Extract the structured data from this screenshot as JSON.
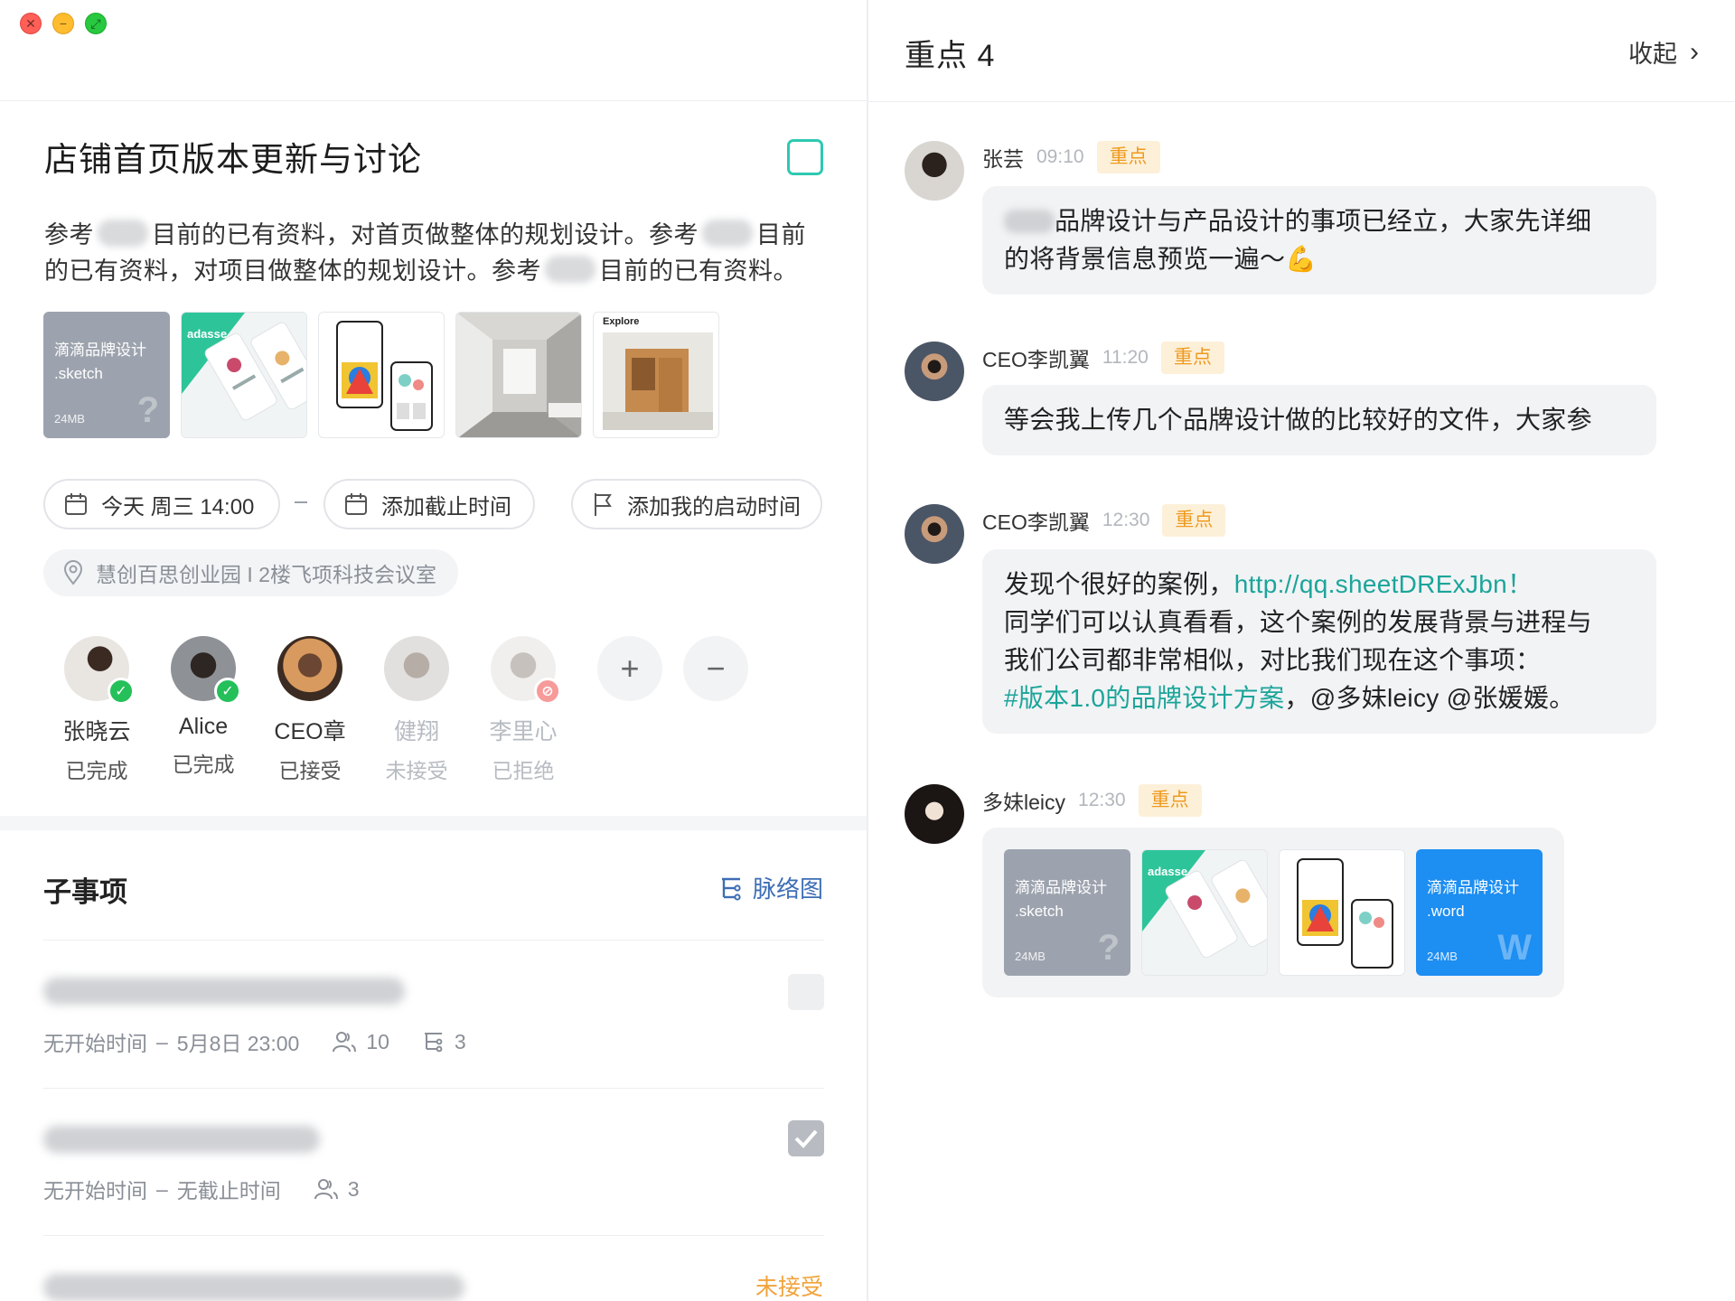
{
  "window": {
    "close_glyph": "✕",
    "minimize_glyph": "−",
    "zoom_glyph": "⤢"
  },
  "task": {
    "title": "店铺首页版本更新与讨论",
    "description_parts": [
      "参考",
      "目前的已有资料，对首页做整体的规划设计。参考",
      "目前",
      "的已有资料，对项目做整体的规划设计。参考",
      "目前的已有资料。"
    ],
    "attachments": [
      {
        "type": "file",
        "name": "滴滴品牌设计",
        "ext": ".sketch",
        "size": "24MB",
        "icon": "question-mark-icon"
      },
      {
        "type": "image",
        "label": "adasse"
      },
      {
        "type": "image",
        "label": ""
      },
      {
        "type": "image",
        "label": ""
      },
      {
        "type": "image",
        "label": "Explore"
      }
    ],
    "start_time": "今天 周三 14:00",
    "add_deadline": "添加截止时间",
    "add_my_start": "添加我的启动时间",
    "location": "慧创百思创业园 I 2楼飞项科技会议室",
    "members": [
      {
        "name": "张晓云",
        "status": "已完成",
        "badge": "done"
      },
      {
        "name": "Alice",
        "status": "已完成",
        "badge": "done"
      },
      {
        "name": "CEO章",
        "status": "已接受",
        "badge": ""
      },
      {
        "name": "健翔",
        "status": "未接受",
        "badge": ""
      },
      {
        "name": "李里心",
        "status": "已拒绝",
        "badge": "rejected"
      }
    ],
    "add_member": "+",
    "remove_member": "−"
  },
  "subtasks": {
    "title": "子事项",
    "graph_link": "脉络图",
    "items": [
      {
        "meta_start": "无开始时间",
        "meta_sep": "–",
        "meta_end": "5月8日 23:00",
        "members": "10",
        "children": "3",
        "checked": false
      },
      {
        "meta_start": "无开始时间",
        "meta_sep": "–",
        "meta_end": "无截止时间",
        "members": "3",
        "checked": true
      },
      {
        "status": "未接受"
      }
    ]
  },
  "panel": {
    "title": "重点 4",
    "collapse": "收起",
    "messages": [
      {
        "author": "张芸",
        "time": "09:10",
        "tag": "重点",
        "text_a": "品牌设计与产品设计的事项已经立，大家先详细",
        "text_b": "的将背景信息预览一遍～",
        "emoji": "💪"
      },
      {
        "author": "CEO李凯翼",
        "time": "11:20",
        "tag": "重点",
        "text": "等会我上传几个品牌设计做的比较好的文件，大家参"
      },
      {
        "author": "CEO李凯翼",
        "time": "12:30",
        "tag": "重点",
        "line1_a": "发现个很好的案例，",
        "line1_link": "http://qq.sheetDRExJbn！",
        "line2": "同学们可以认真看看，这个案例的发展背景与进程与",
        "line3": "我们公司都非常相似，对比我们现在这个事项：",
        "line4_link": "#版本1.0的品牌设计方案",
        "line4_rest": "，@多妹leicy @张媛媛。"
      },
      {
        "author": "多妹leicy",
        "time": "12:30",
        "tag": "重点",
        "files": [
          {
            "type": "file",
            "name": "滴滴品牌设计",
            "ext": ".sketch",
            "size": "24MB"
          },
          {
            "type": "image",
            "label": "adasse"
          },
          {
            "type": "image",
            "label": ""
          },
          {
            "type": "file",
            "name": "滴滴品牌设计",
            "ext": ".word",
            "size": "24MB",
            "mark": "W"
          }
        ]
      }
    ]
  },
  "colors": {
    "accent": "#2ec9b0",
    "link": "#1ba59a",
    "tag_bg": "#fdf0d9",
    "tag_text": "#ee9a1e",
    "word_file": "#1d8ef2",
    "sketch_file": "#9da3ae"
  }
}
